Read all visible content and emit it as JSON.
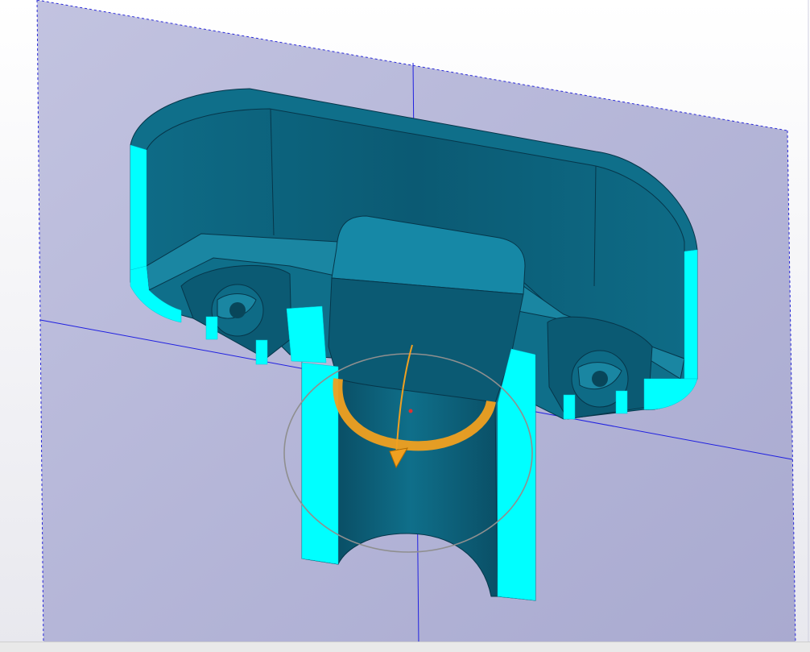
{
  "viewport": {
    "view": "section-view",
    "colors": {
      "background_top": "#ffffff",
      "background_bottom": "#e8e8ee",
      "section_plane": "#b4b6d8",
      "section_plane_edge": "#2a2ad8",
      "model_body": "#0f6f8a",
      "model_body_dark": "#0a4f66",
      "section_face": "#00ffff",
      "triad_arrow": "#f0a020",
      "rotation_ring": "#8f8f8f"
    }
  },
  "manipulator": {
    "icon": "rotate-arrow-icon"
  }
}
